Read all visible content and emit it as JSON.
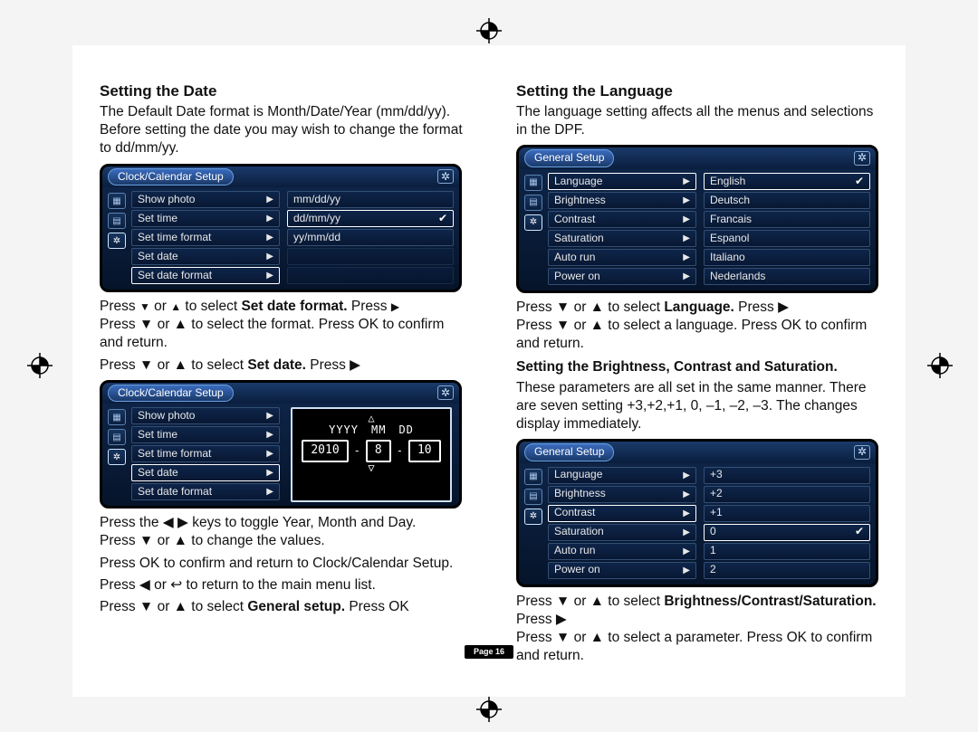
{
  "left": {
    "title": "Setting the Date",
    "intro": "The Default Date format is Month/Date/Year (mm/dd/yy). Before setting the date you may wish to change the format to dd/mm/yy.",
    "dev1": {
      "tab": "Clock/Calendar Setup",
      "menu": [
        "Show photo",
        "Set time",
        "Set time format",
        "Set date",
        "Set date format"
      ],
      "sel": 4,
      "vals": [
        "mm/dd/yy",
        "dd/mm/yy",
        "yy/mm/dd"
      ],
      "valsel": 1
    },
    "cap1_a": "Press ",
    "cap1_b": " or ",
    "cap1_c": " to select ",
    "cap1_bold": "Set date format.",
    "cap1_d": " Press ",
    "cap2": "Press ▼ or ▲ to select the format. Press OK to confirm and return.",
    "cap3_a": "Press ▼ or ▲ to select ",
    "cap3_bold": "Set date.",
    "cap3_b": " Press ▶",
    "dev2": {
      "tab": "Clock/Calendar Setup",
      "menu": [
        "Show photo",
        "Set time",
        "Set time format",
        "Set date",
        "Set date format"
      ],
      "sel": 3,
      "head": [
        "YYYY",
        "MM",
        "DD"
      ],
      "vals": [
        "2010",
        "8",
        "10"
      ]
    },
    "cap4": "Press the ◀ ▶ keys to toggle Year, Month and Day.",
    "cap5": "Press ▼ or ▲ to change the values.",
    "cap6": "Press OK to confirm and return to Clock/Calendar Setup.",
    "cap7": "Press ◀ or ↩ to return to the main menu list.",
    "cap8_a": "Press ▼ or ▲ to select ",
    "cap8_bold": "General setup.",
    "cap8_b": " Press OK"
  },
  "right": {
    "title": "Setting the Language",
    "intro": "The language setting affects all the menus and selections in the DPF.",
    "dev1": {
      "tab": "General Setup",
      "menu": [
        "Language",
        "Brightness",
        "Contrast",
        "Saturation",
        "Auto run",
        "Power on"
      ],
      "sel": 0,
      "vals": [
        "English",
        "Deutsch",
        "Francais",
        "Espanol",
        "Italiano",
        "Nederlands"
      ],
      "valsel": 0
    },
    "cap1_a": "Press ▼ or ▲ to select ",
    "cap1_bold": "Language.",
    "cap1_b": " Press ▶",
    "cap2": "Press ▼ or ▲ to select a language. Press OK to confirm and return.",
    "sub2": "Setting the Brightness, Contrast and Saturation.",
    "para2": "These parameters are all set in the same manner. There are seven setting +3,+2,+1, 0, –1, –2, –3. The changes display immediately.",
    "dev2": {
      "tab": "General Setup",
      "menu": [
        "Language",
        "Brightness",
        "Contrast",
        "Saturation",
        "Auto run",
        "Power on"
      ],
      "sel": 2,
      "vals": [
        "+3",
        "+2",
        "+1",
        "0",
        "1",
        "2"
      ],
      "valsel": 3
    },
    "cap3_a": "Press ▼ or ▲ to select ",
    "cap3_bold": "Brightness/Contrast/Saturation.",
    "cap3_b": " Press ▶",
    "cap4": "Press ▼ or ▲ to select a parameter. Press OK to confirm and return."
  },
  "page": "Page 16"
}
